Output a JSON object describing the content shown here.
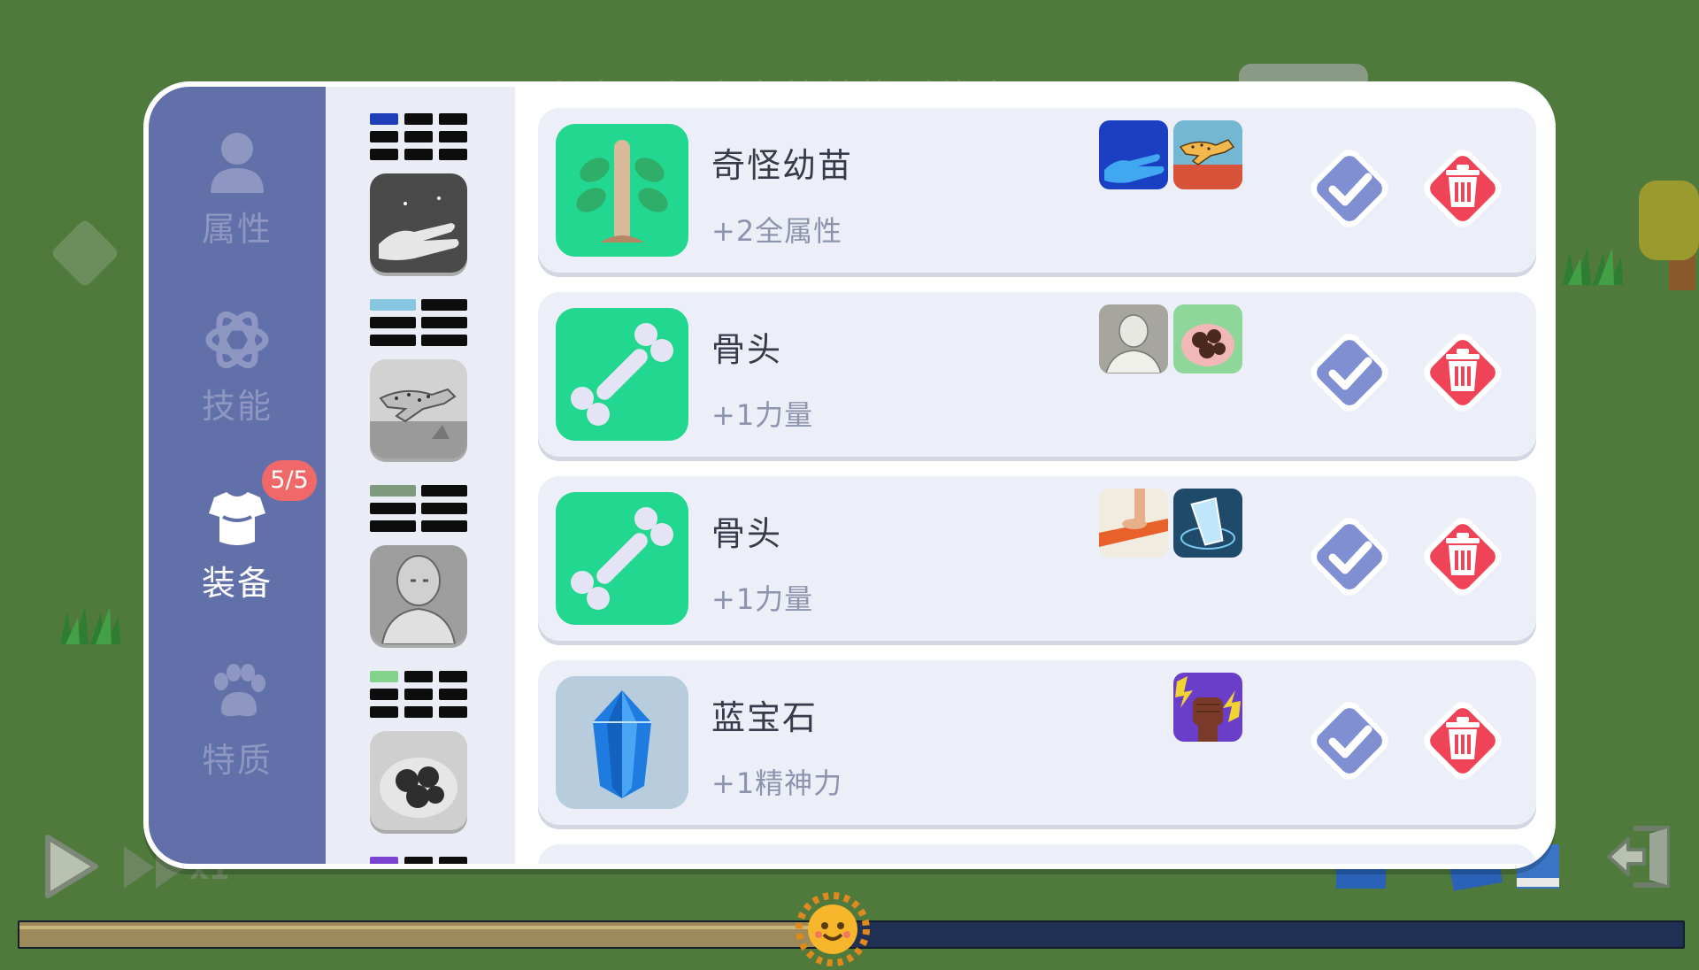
{
  "background": {
    "hint_text": "任务：探索森林并找到线索",
    "speed_label": "x1"
  },
  "side_nav": {
    "items": [
      {
        "label": "属性",
        "icon": "person-icon",
        "active": false
      },
      {
        "label": "技能",
        "icon": "atom-icon",
        "active": false
      },
      {
        "label": "装备",
        "icon": "armor-icon",
        "active": true,
        "badge": "5/5"
      },
      {
        "label": "特质",
        "icon": "paw-icon",
        "active": false
      }
    ]
  },
  "slots": [
    {
      "color": "#1e3eb8",
      "art": "moon-hand",
      "filled": 1
    },
    {
      "color": "#86c6e0",
      "art": "cheetah",
      "filled": 1
    },
    {
      "color": "#7d9a7d",
      "art": "statue",
      "filled": 1
    },
    {
      "color": "#83d48a",
      "art": "coal",
      "filled": 1
    },
    {
      "color": "#7a44d0",
      "art": "",
      "filled": 1
    }
  ],
  "equipment": [
    {
      "name": "奇怪幼苗",
      "effect": "+2全属性",
      "icon": "sapling-icon",
      "tile_color": "#22d890",
      "sources": [
        "moon-hand-icon",
        "cheetah-icon"
      ]
    },
    {
      "name": "骨头",
      "effect": "+1力量",
      "icon": "bone-icon",
      "tile_color": "#22d890",
      "sources": [
        "statue-icon",
        "coal-icon"
      ]
    },
    {
      "name": "骨头",
      "effect": "+1力量",
      "icon": "bone-icon",
      "tile_color": "#22d890",
      "sources": [
        "foot-board-icon",
        "water-glass-icon"
      ]
    },
    {
      "name": "蓝宝石",
      "effect": "+1精神力",
      "icon": "sapphire-icon",
      "tile_color": "#b7ccdd",
      "sources": [
        "lightning-fist-icon"
      ]
    }
  ],
  "colors": {
    "nav_bg": "#6270aa",
    "accent_green": "#22d890",
    "delete_red": "#ef4358",
    "equip_blue": "#7f8fd2",
    "badge_red": "#f06968"
  },
  "time_of_day_progress": 0.49
}
